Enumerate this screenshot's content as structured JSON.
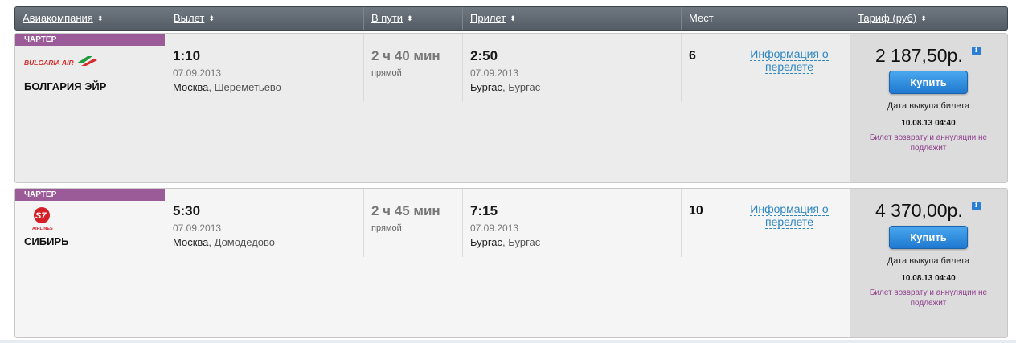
{
  "header": {
    "airline": "Авиакомпания",
    "departure": "Вылет",
    "duration": "В пути",
    "arrival": "Прилет",
    "seats": "Мест",
    "fare": "Тариф (руб)",
    "sort_icon": "sort-arrows-icon"
  },
  "flights": [
    {
      "badge": "ЧАРТЕР",
      "logo_text": "BULGARIA AIR",
      "airline": "БОЛГАРИЯ ЭЙР",
      "dep_time": "1:10",
      "dep_date": "07.09.2013",
      "dep_city": "Москва",
      "dep_airport": "Шереметьево",
      "duration": "2 ч 40 мин",
      "stops": "прямой",
      "arr_time": "2:50",
      "arr_date": "07.09.2013",
      "arr_city": "Бургас",
      "arr_airport": "Бургас",
      "seats": "6",
      "info_line1": "Информация о",
      "info_line2": "перелете",
      "price": "2 187,50р.",
      "buy": "Купить",
      "deadline_label": "Дата выкупа билета",
      "deadline_value": "10.08.13 04:40",
      "nonrefund": "Билет возврату и аннуляции не подлежит"
    },
    {
      "badge": "ЧАРТЕР",
      "logo_text": "AIRLINES",
      "airline": "СИБИРЬ",
      "dep_time": "5:30",
      "dep_date": "07.09.2013",
      "dep_city": "Москва",
      "dep_airport": "Домодедово",
      "duration": "2 ч 45 мин",
      "stops": "прямой",
      "arr_time": "7:15",
      "arr_date": "07.09.2013",
      "arr_city": "Бургас",
      "arr_airport": "Бургас",
      "seats": "10",
      "info_line1": "Информация о",
      "info_line2": "перелете",
      "price": "4 370,00р.",
      "buy": "Купить",
      "deadline_label": "Дата выкупа билета",
      "deadline_value": "10.08.13 04:40",
      "nonrefund": "Билет возврату и аннуляции не подлежит"
    }
  ],
  "colors": {
    "charter_badge": "#9b5a98",
    "buy_button": "#2a86dc",
    "link": "#2e86c1",
    "nonrefund": "#8e3e8c"
  }
}
